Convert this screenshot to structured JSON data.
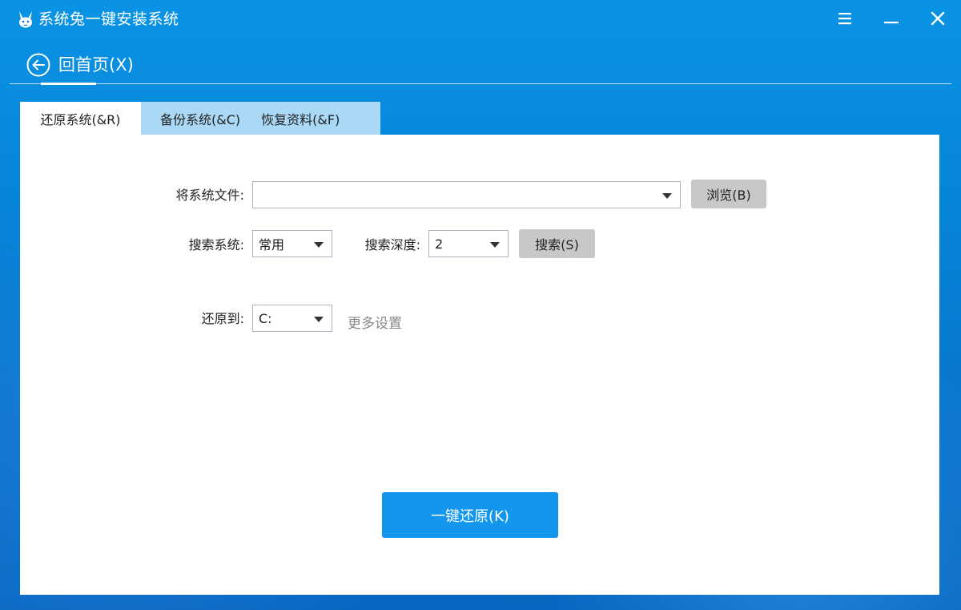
{
  "window": {
    "title": "系统兔一键安装系统",
    "menu_icon": "hamburger-icon",
    "min_icon": "minimize-icon",
    "close_icon": "close-icon"
  },
  "header": {
    "back_label": "回首页(X)",
    "back_icon": "back-arrow-icon"
  },
  "tabs": [
    {
      "label": "还原系统(&R)",
      "active": true
    },
    {
      "label": "备份系统(&C)",
      "active": false
    },
    {
      "label": "恢复资料(&F)",
      "active": false
    }
  ],
  "form": {
    "system_file_label": "将系统文件:",
    "system_file_value": "",
    "browse_label": "浏览(B)",
    "search_system_label": "搜索系统:",
    "search_system_value": "常用",
    "search_depth_label": "搜索深度:",
    "search_depth_value": "2",
    "search_button_label": "搜索(S)",
    "restore_to_label": "还原到:",
    "restore_to_value": "C:",
    "more_settings_label": "更多设置"
  },
  "actions": {
    "restore_label": "一键还原(K)"
  },
  "colors": {
    "background": "#0682d6",
    "primary_button": "#1296ee",
    "inactive_tab": "#a9d9f6",
    "gray_button": "#c8c8c8"
  }
}
